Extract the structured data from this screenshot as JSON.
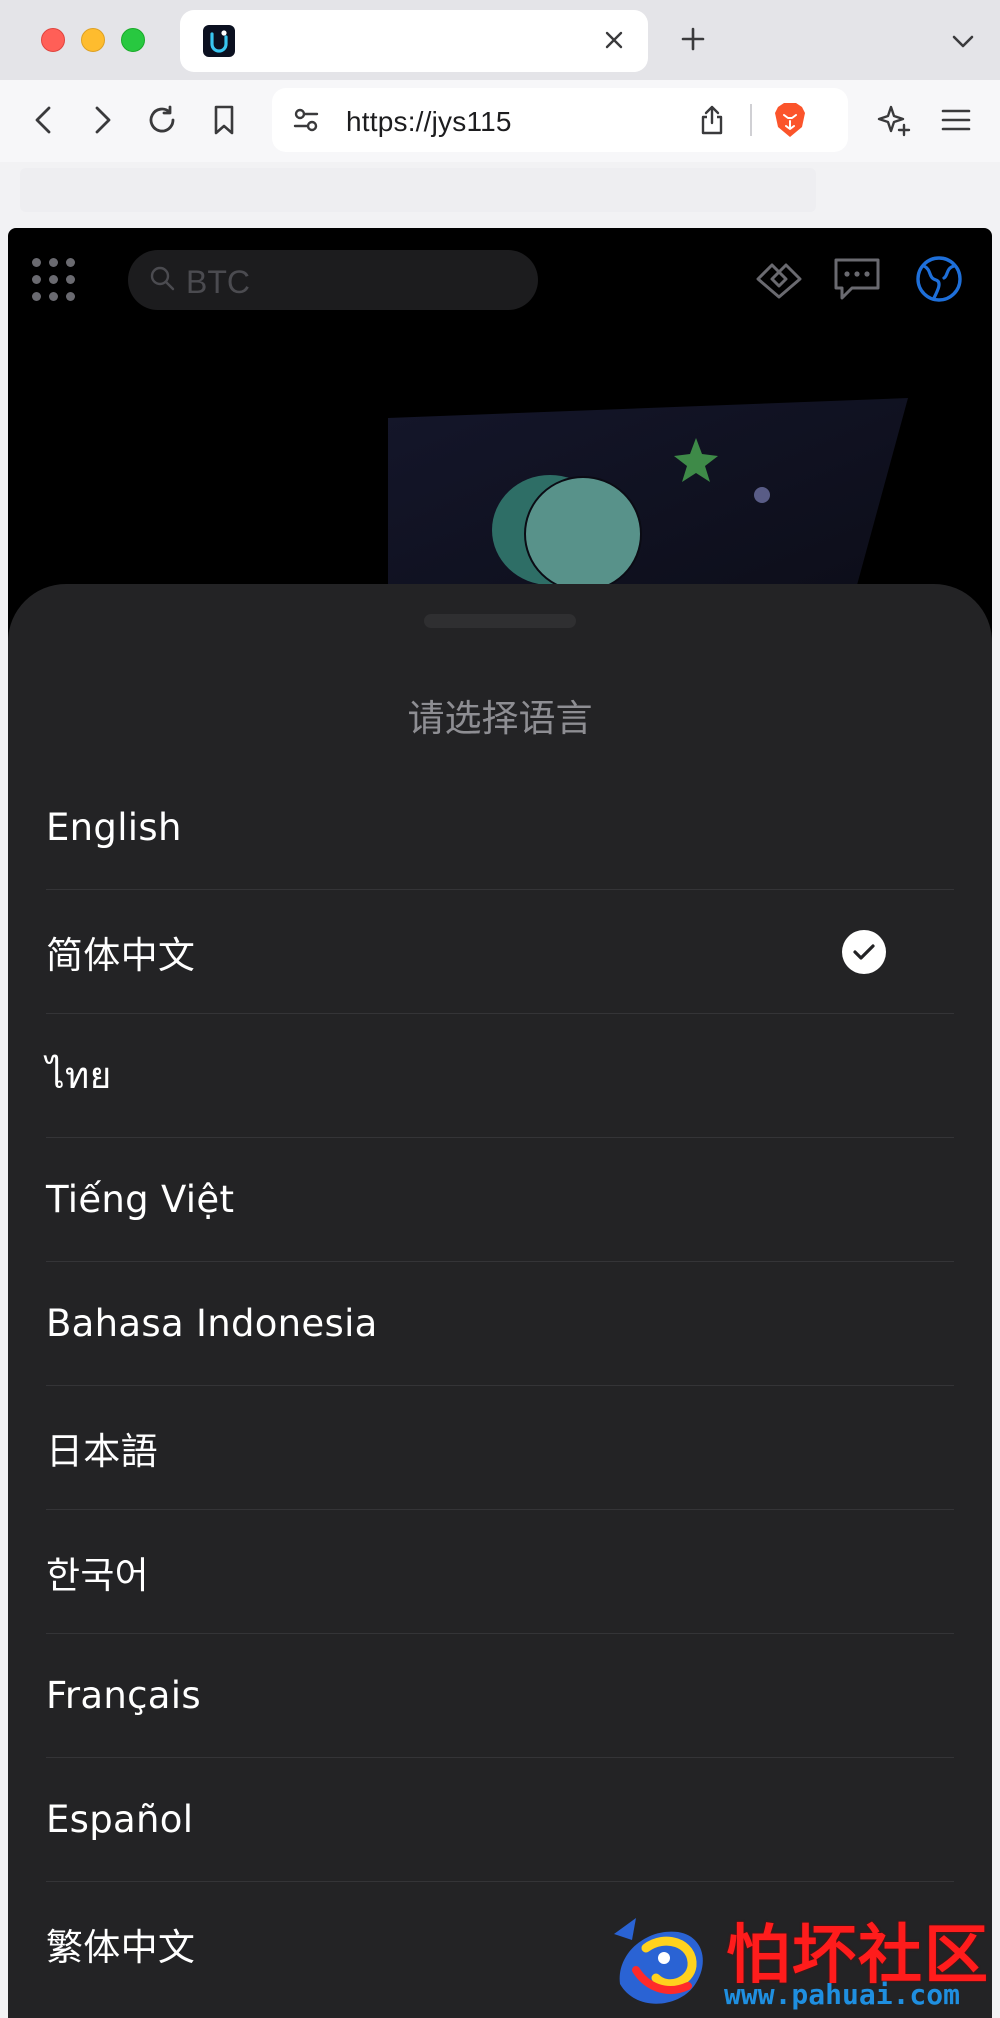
{
  "browser": {
    "url": "https://jys115",
    "colors": {
      "tabbar": "#e4e4e8",
      "toolbar": "#f7f7f9",
      "brave_orange": "#fb542b"
    },
    "icons": [
      "close-icon",
      "plus-icon",
      "chevron-down-icon",
      "back-icon",
      "forward-icon",
      "reload-icon",
      "bookmark-icon",
      "tune-icon",
      "share-icon",
      "brave-lion-icon",
      "sparkle-icon",
      "menu-icon"
    ]
  },
  "app": {
    "search": {
      "placeholder": "BTC"
    },
    "header_icons": [
      "grid-icon",
      "handshake-icon",
      "chat-icon",
      "globe-icon"
    ],
    "colors": {
      "background": "#000000",
      "sheet": "#232325",
      "accent_blue": "#1e6fd9"
    }
  },
  "language_sheet": {
    "title": "请选择语言",
    "selected": "简体中文",
    "languages": [
      {
        "label": "English"
      },
      {
        "label": "简体中文"
      },
      {
        "label": "ไทย"
      },
      {
        "label": "Tiếng Việt"
      },
      {
        "label": "Bahasa Indonesia"
      },
      {
        "label": "日本語"
      },
      {
        "label": "한국어"
      },
      {
        "label": "Français"
      },
      {
        "label": "Español"
      },
      {
        "label": "繁体中文"
      }
    ]
  },
  "watermark": {
    "text": "怕坏社区",
    "url": "www.pahuai.com"
  }
}
